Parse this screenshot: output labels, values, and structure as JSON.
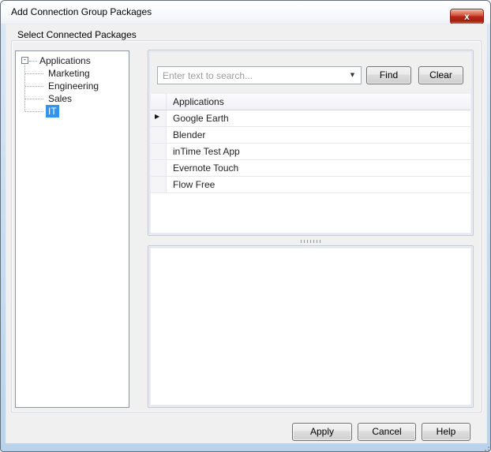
{
  "window": {
    "title": "Add Connection Group Packages",
    "close_glyph": "x"
  },
  "group_box": {
    "label": "Select Connected Packages"
  },
  "tree": {
    "root": {
      "label": "Applications"
    },
    "children": [
      {
        "label": "Marketing",
        "selected": false
      },
      {
        "label": "Engineering",
        "selected": false
      },
      {
        "label": "Sales",
        "selected": false
      },
      {
        "label": "IT",
        "selected": true
      }
    ]
  },
  "search": {
    "placeholder": "Enter text to search...",
    "value": "",
    "find_label": "Find",
    "clear_label": "Clear"
  },
  "table": {
    "columns": [
      "Applications"
    ],
    "rows": [
      {
        "name": "Google Earth",
        "current": true
      },
      {
        "name": "Blender",
        "current": false
      },
      {
        "name": "inTime Test App",
        "current": false
      },
      {
        "name": "Evernote Touch",
        "current": false
      },
      {
        "name": "Flow Free",
        "current": false
      }
    ]
  },
  "footer": {
    "apply_label": "Apply",
    "cancel_label": "Cancel",
    "help_label": "Help"
  },
  "icons": {
    "tree_collapse_glyph": "-",
    "combo_dropdown_glyph": "▼",
    "row_indicator_glyph": "▶"
  },
  "colors": {
    "selection_blue": "#3095ef",
    "close_button_red": "#b62718",
    "dialog_background": "#f0f0f0",
    "frame_blue": "#c3d9ef"
  }
}
